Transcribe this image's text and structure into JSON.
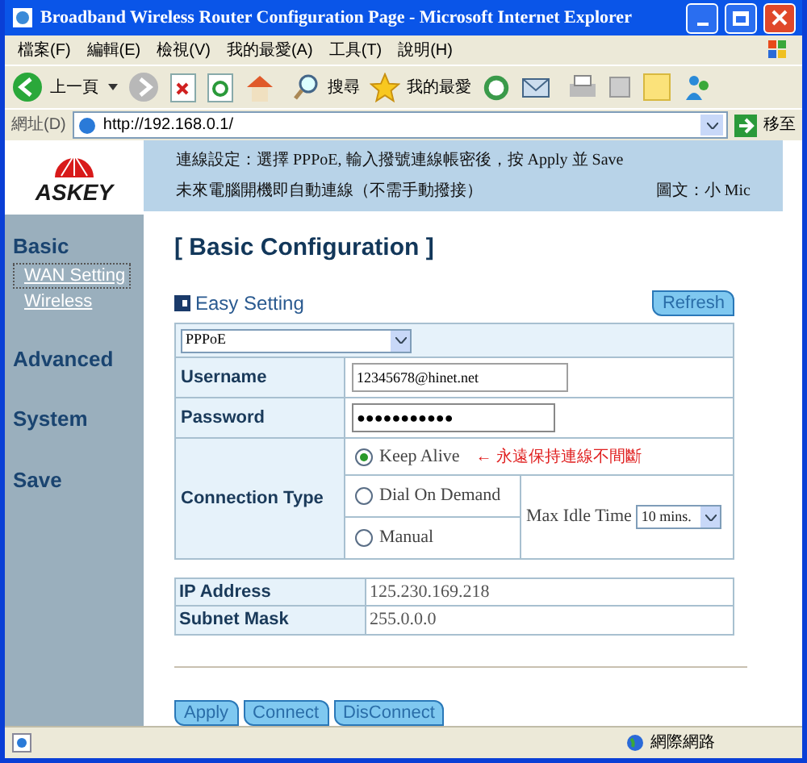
{
  "window": {
    "title": "Broadband Wireless Router Configuration Page - Microsoft Internet Explorer"
  },
  "menu": [
    "檔案(F)",
    "編輯(E)",
    "檢視(V)",
    "我的最愛(A)",
    "工具(T)",
    "說明(H)"
  ],
  "toolbar": {
    "back": "上一頁",
    "search": "搜尋",
    "favorites": "我的最愛"
  },
  "address": {
    "label": "網址(D)",
    "url": "http://192.168.0.1/",
    "go": "移至"
  },
  "logo": "ASKEY",
  "banner": {
    "line1": "連線設定：選擇 PPPoE, 輸入撥號連線帳密後，按 Apply 並 Save",
    "line2": "未來電腦開機即自動連線（不需手動撥接）",
    "credit": "圖文：小 Mic"
  },
  "sidebar": [
    {
      "label": "Basic",
      "children": [
        {
          "label": "WAN Setting",
          "selected": true
        },
        {
          "label": "Wireless",
          "selected": false
        }
      ]
    },
    {
      "label": "Advanced"
    },
    {
      "label": "System"
    },
    {
      "label": "Save"
    }
  ],
  "page_title": "[ Basic Configuration ]",
  "section": {
    "title": "Easy Setting",
    "refresh": "Refresh"
  },
  "form": {
    "mode": "PPPoE",
    "username_label": "Username",
    "username": "12345678@hinet.net",
    "password_label": "Password",
    "password": "●●●●●●●●●●●",
    "connection_label": "Connection Type",
    "options": [
      {
        "label": "Keep Alive",
        "selected": true
      },
      {
        "label": "Dial On Demand",
        "selected": false
      },
      {
        "label": "Manual",
        "selected": false
      }
    ],
    "note": "← 永遠保持連線不間斷",
    "idle_label": "Max Idle Time",
    "idle": "10 mins."
  },
  "info": [
    {
      "label": "IP Address",
      "value": "125.230.169.218"
    },
    {
      "label": "Subnet Mask",
      "value": "255.0.0.0"
    }
  ],
  "buttons": [
    "Apply",
    "Connect",
    "DisConnect"
  ],
  "status_bar": {
    "zone": "網際網路"
  }
}
